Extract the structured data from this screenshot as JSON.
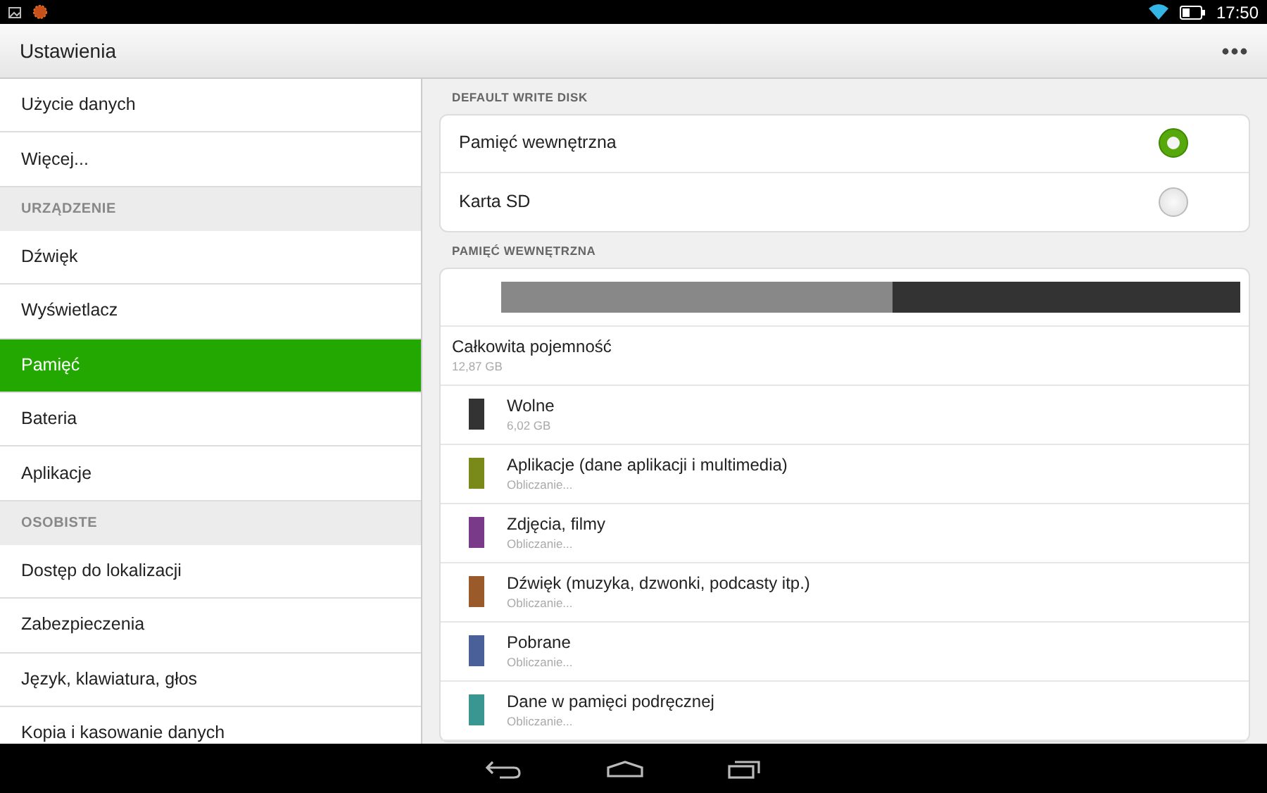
{
  "status_bar": {
    "time": "17:50"
  },
  "action_bar": {
    "title": "Ustawienia"
  },
  "sidebar": {
    "items": [
      {
        "kind": "item",
        "label": "Użycie danych",
        "selected": false
      },
      {
        "kind": "item",
        "label": "Więcej...",
        "selected": false
      },
      {
        "kind": "header",
        "label": "URZĄDZENIE"
      },
      {
        "kind": "item",
        "label": "Dźwięk",
        "selected": false
      },
      {
        "kind": "item",
        "label": "Wyświetlacz",
        "selected": false
      },
      {
        "kind": "item",
        "label": "Pamięć",
        "selected": true
      },
      {
        "kind": "item",
        "label": "Bateria",
        "selected": false
      },
      {
        "kind": "item",
        "label": "Aplikacje",
        "selected": false
      },
      {
        "kind": "header",
        "label": "OSOBISTE"
      },
      {
        "kind": "item",
        "label": "Dostęp do lokalizacji",
        "selected": false
      },
      {
        "kind": "item",
        "label": "Zabezpieczenia",
        "selected": false
      },
      {
        "kind": "item",
        "label": "Język, klawiatura, głos",
        "selected": false
      },
      {
        "kind": "item",
        "label": "Kopia i kasowanie danych",
        "selected": false
      }
    ]
  },
  "write_disk": {
    "heading": "DEFAULT WRITE DISK",
    "options": [
      {
        "label": "Pamięć wewnętrzna",
        "selected": true
      },
      {
        "label": "Karta SD",
        "selected": false
      }
    ]
  },
  "internal_storage": {
    "heading": "PAMIĘĆ WEWNĘTRZNA",
    "usage_bar": {
      "level": 0.53
    },
    "total": {
      "label": "Całkowita pojemność",
      "value": "12,87 GB"
    },
    "categories": [
      {
        "label": "Wolne",
        "value": "6,02 GB",
        "color": "#333333"
      },
      {
        "label": "Aplikacje (dane aplikacji i multimedia)",
        "value": "Obliczanie...",
        "color": "#7a8a1a"
      },
      {
        "label": "Zdjęcia, filmy",
        "value": "Obliczanie...",
        "color": "#7a3a8a"
      },
      {
        "label": "Dźwięk (muzyka, dzwonki, podcasty itp.)",
        "value": "Obliczanie...",
        "color": "#9a5a2a"
      },
      {
        "label": "Pobrane",
        "value": "Obliczanie...",
        "color": "#4a6098"
      },
      {
        "label": "Dane w pamięci podręcznej",
        "value": "Obliczanie...",
        "color": "#3a9690"
      }
    ]
  }
}
